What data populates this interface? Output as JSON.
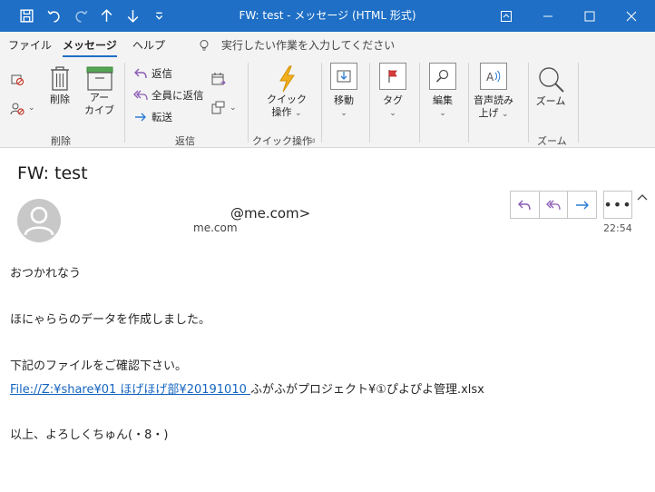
{
  "window": {
    "title": "FW: test  -  メッセージ (HTML 形式)"
  },
  "menu": {
    "tabs": [
      "ファイル",
      "メッセージ",
      "ヘルプ"
    ],
    "active_tab": "メッセージ",
    "tell_me": "実行したい作業を入力してください"
  },
  "ribbon": {
    "delete_label": "削除",
    "archive_label_line1": "アー",
    "archive_label_line2": "カイブ",
    "group_delete": "削除",
    "reply_label": "返信",
    "reply_all_label": "全員に返信",
    "forward_label": "転送",
    "group_respond": "返信",
    "quick_steps_line1": "クイック",
    "quick_steps_line2": "操作",
    "group_quick_steps": "クイック操作",
    "move_label": "移動",
    "tags_label": "タグ",
    "editing_label": "編集",
    "read_aloud_line1": "音声読み",
    "read_aloud_line2": "上げ",
    "zoom_label": "ズーム",
    "group_zoom": "ズーム"
  },
  "message": {
    "subject": "FW: test",
    "sender_email": "@me.com>",
    "sender_sub": "me.com",
    "time": "22:54",
    "body": {
      "line1": "おつかれなう",
      "line2": "ほにゃららのデータを作成しました。",
      "line3": "下記のファイルをご確認下さい。",
      "link_text": "File://Z:¥share¥01 ほげほげ部¥20191010 ",
      "link_rest": "ふがふがプロジェクト¥①ぴよぴよ管理.xlsx",
      "line5": "以上、よろしくちゅん(・8・)"
    }
  },
  "colors": {
    "titlebar": "#1e6fc5",
    "ribbon_bg": "#f3f3f3",
    "link": "#1565c0",
    "reply_purple": "#8a5bb5",
    "forward_blue": "#2b7cd3"
  }
}
